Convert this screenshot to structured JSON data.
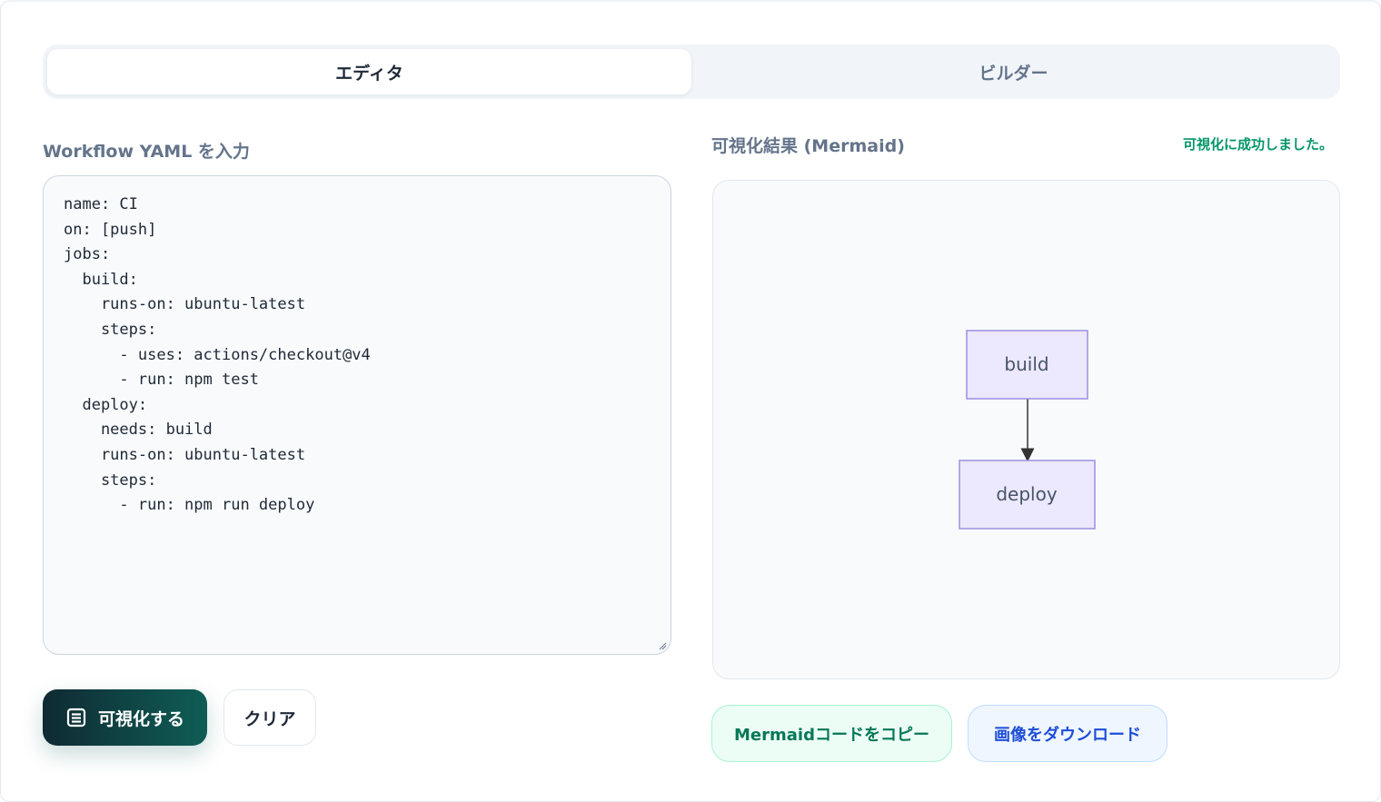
{
  "tabs": [
    {
      "label": "エディタ",
      "active": true
    },
    {
      "label": "ビルダー",
      "active": false
    }
  ],
  "editor": {
    "label": "Workflow YAML を入力",
    "lines": [
      "name: CI",
      "on: [push]",
      "jobs:",
      "  build:",
      "    runs-on: ubuntu-latest",
      "    steps:",
      "      - uses: actions/checkout@v4",
      "      - run: npm test",
      "  deploy:",
      "    needs: build",
      "    runs-on: ubuntu-latest",
      "    steps:",
      "      - run: npm run deploy"
    ]
  },
  "preview": {
    "label": "可視化結果 (Mermaid)",
    "status": "可視化に成功しました。",
    "status_color": "#059669",
    "diagram": {
      "nodes": [
        {
          "id": "build",
          "label": "build"
        },
        {
          "id": "deploy",
          "label": "deploy"
        }
      ],
      "edges": [
        {
          "from": "build",
          "to": "deploy"
        }
      ],
      "node_fill": "#ece8fd",
      "node_stroke": "#9c8fe0"
    }
  },
  "actions": {
    "visualize_label": "可視化する",
    "visualize_icon": "document-list-icon",
    "clear_label": "クリア",
    "copy_label": "Mermaidコードをコピー",
    "download_label": "画像をダウンロード"
  }
}
